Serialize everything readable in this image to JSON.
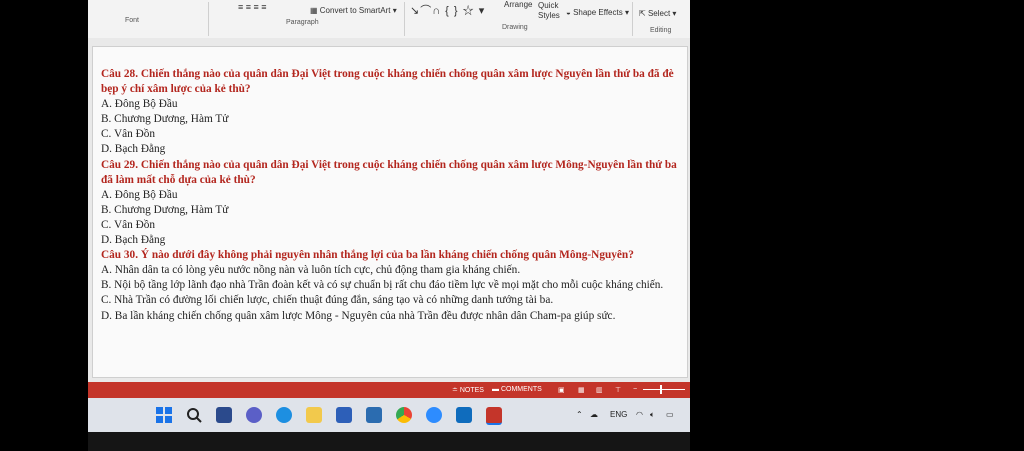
{
  "ribbon": {
    "font_label": "Font",
    "paragraph_label": "Paragraph",
    "convert_smartart": "Convert to SmartArt",
    "drawing_label": "Drawing",
    "arrange": "Arrange",
    "quick_styles": "Quick Styles",
    "shape_effects": "Shape Effects",
    "select": "Select",
    "editing_label": "Editing"
  },
  "slide": {
    "questions": [
      {
        "title": "Câu 28. Chiến thắng nào của quân dân Đại Việt trong cuộc kháng chiến chống quân xâm lược Nguyên lần thứ ba đã đè bẹp ý chí xâm lược của kẻ thù?",
        "options": [
          "A. Đông Bộ Đầu",
          "B. Chương Dương, Hàm Tử",
          "C. Vân Đồn",
          "D. Bạch Đằng"
        ]
      },
      {
        "title": "Câu 29. Chiến thắng nào của quân dân Đại Việt trong cuộc kháng chiến chống quân xâm lược Mông-Nguyên lần thứ ba đã làm mất chỗ dựa của kẻ thù?",
        "options": [
          "A. Đông Bộ Đầu",
          "B. Chương Dương, Hàm Tử",
          "C. Vân Đồn",
          "D. Bạch Đằng"
        ]
      },
      {
        "title": "Câu 30. Ý nào dưới đây không phải nguyên nhân thắng lợi của ba lần kháng chiến chống quân Mông-Nguyên?",
        "options": [
          "A. Nhân dân ta có lòng yêu nước nồng nàn và luôn tích cực, chủ động tham gia kháng chiến.",
          "B. Nội bộ tầng lớp lãnh đạo nhà Trần đoàn kết và có sự chuẩn bị rất chu đáo tiềm lực về mọi mặt cho mỗi cuộc kháng chiến.",
          "C. Nhà Trần có đường lối chiến lược, chiến thuật đúng đắn, sáng tạo và có những danh tướng tài ba.",
          "D. Ba lần kháng chiến chống quân xâm lược Mông - Nguyên của nhà Trần đều được nhân dân Cham-pa giúp sức."
        ]
      }
    ]
  },
  "status": {
    "notes": "NOTES",
    "comments": "COMMENTS"
  },
  "taskbar": {
    "lang": "ENG"
  },
  "colors": {
    "question": "#b3261e",
    "status_bar": "#c4352a"
  }
}
